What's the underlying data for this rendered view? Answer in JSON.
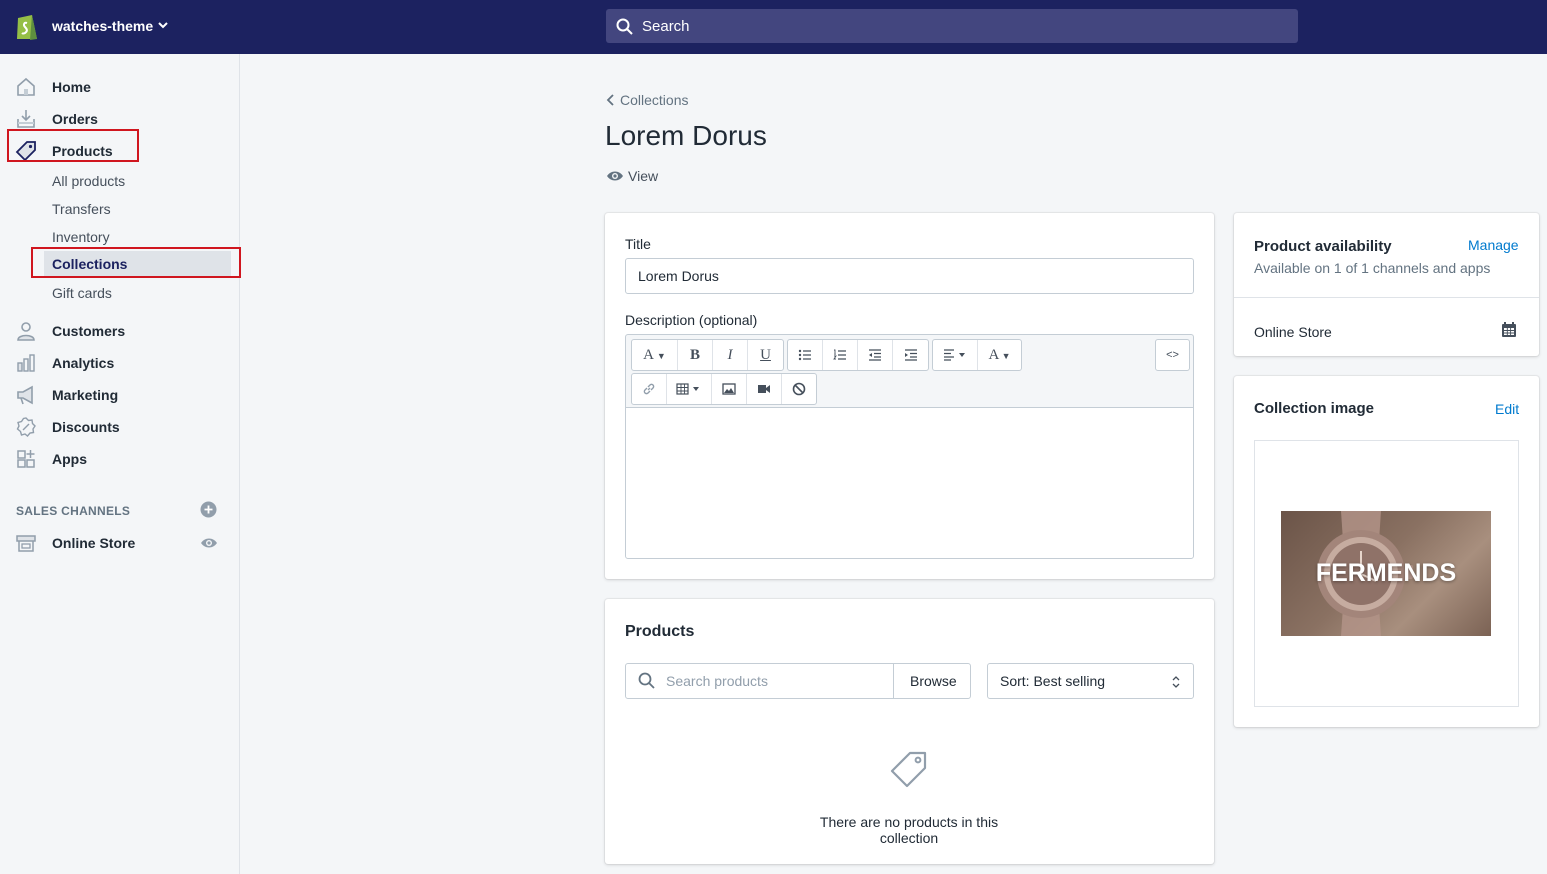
{
  "topbar": {
    "store_name": "watches-theme",
    "search_placeholder": "Search"
  },
  "sidebar": {
    "items": [
      {
        "label": "Home"
      },
      {
        "label": "Orders"
      },
      {
        "label": "Products"
      },
      {
        "label": "Customers"
      },
      {
        "label": "Analytics"
      },
      {
        "label": "Marketing"
      },
      {
        "label": "Discounts"
      },
      {
        "label": "Apps"
      }
    ],
    "product_subitems": [
      {
        "label": "All products"
      },
      {
        "label": "Transfers"
      },
      {
        "label": "Inventory"
      },
      {
        "label": "Collections"
      },
      {
        "label": "Gift cards"
      }
    ],
    "sales_channels_heading": "SALES CHANNELS",
    "online_store": "Online Store"
  },
  "main": {
    "breadcrumb": "Collections",
    "title": "Lorem Dorus",
    "view_label": "View",
    "form": {
      "title_label": "Title",
      "title_value": "Lorem Dorus",
      "description_label": "Description (optional)",
      "html_toggle": "<>"
    },
    "products": {
      "heading": "Products",
      "search_placeholder": "Search products",
      "browse_label": "Browse",
      "sort_value": "Sort: Best selling",
      "empty_text": "There are no products in this collection"
    },
    "availability": {
      "heading": "Product availability",
      "manage_label": "Manage",
      "subtitle": "Available on 1 of 1 channels and apps",
      "channel": "Online Store"
    },
    "collection_image": {
      "heading": "Collection image",
      "edit_label": "Edit",
      "image_text": "FERMENDS"
    }
  },
  "colors": {
    "topbar": "#1c2260",
    "link": "#007ace",
    "highlight": "#d0161f"
  }
}
